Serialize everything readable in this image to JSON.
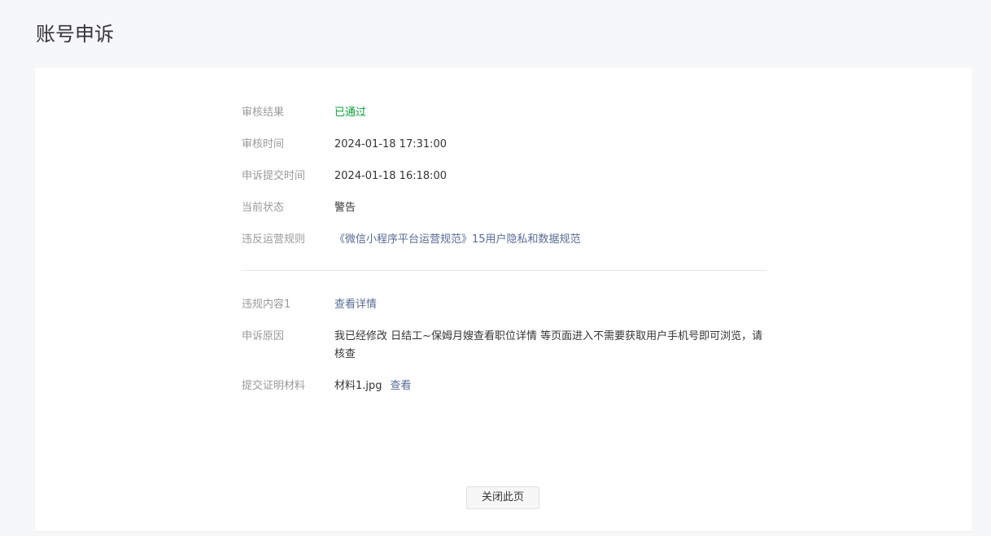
{
  "page_title": "账号申诉",
  "details": {
    "review_result": {
      "label": "审核结果",
      "value": "已通过"
    },
    "review_time": {
      "label": "审核时间",
      "value": "2024-01-18 17:31:00"
    },
    "submit_time": {
      "label": "申诉提交时间",
      "value": "2024-01-18 16:18:00"
    },
    "current_status": {
      "label": "当前状态",
      "value": "警告"
    },
    "violated_rule": {
      "label": "违反运营规则",
      "value": "《微信小程序平台运营规范》15用户隐私和数据规范"
    }
  },
  "appeal": {
    "violation_content": {
      "label": "违规内容1",
      "value": "查看详情"
    },
    "appeal_reason": {
      "label": "申诉原因",
      "value": "我已经修改 日结工~保姆月嫂查看职位详情 等页面进入不需要获取用户手机号即可浏览，请核查"
    },
    "evidence": {
      "label": "提交证明材料",
      "file_name": "材料1.jpg",
      "view_label": "查看"
    }
  },
  "close_button_label": "关闭此页",
  "colors": {
    "success": "#07a33a",
    "link": "#576b95",
    "label": "#9a9a9a"
  }
}
